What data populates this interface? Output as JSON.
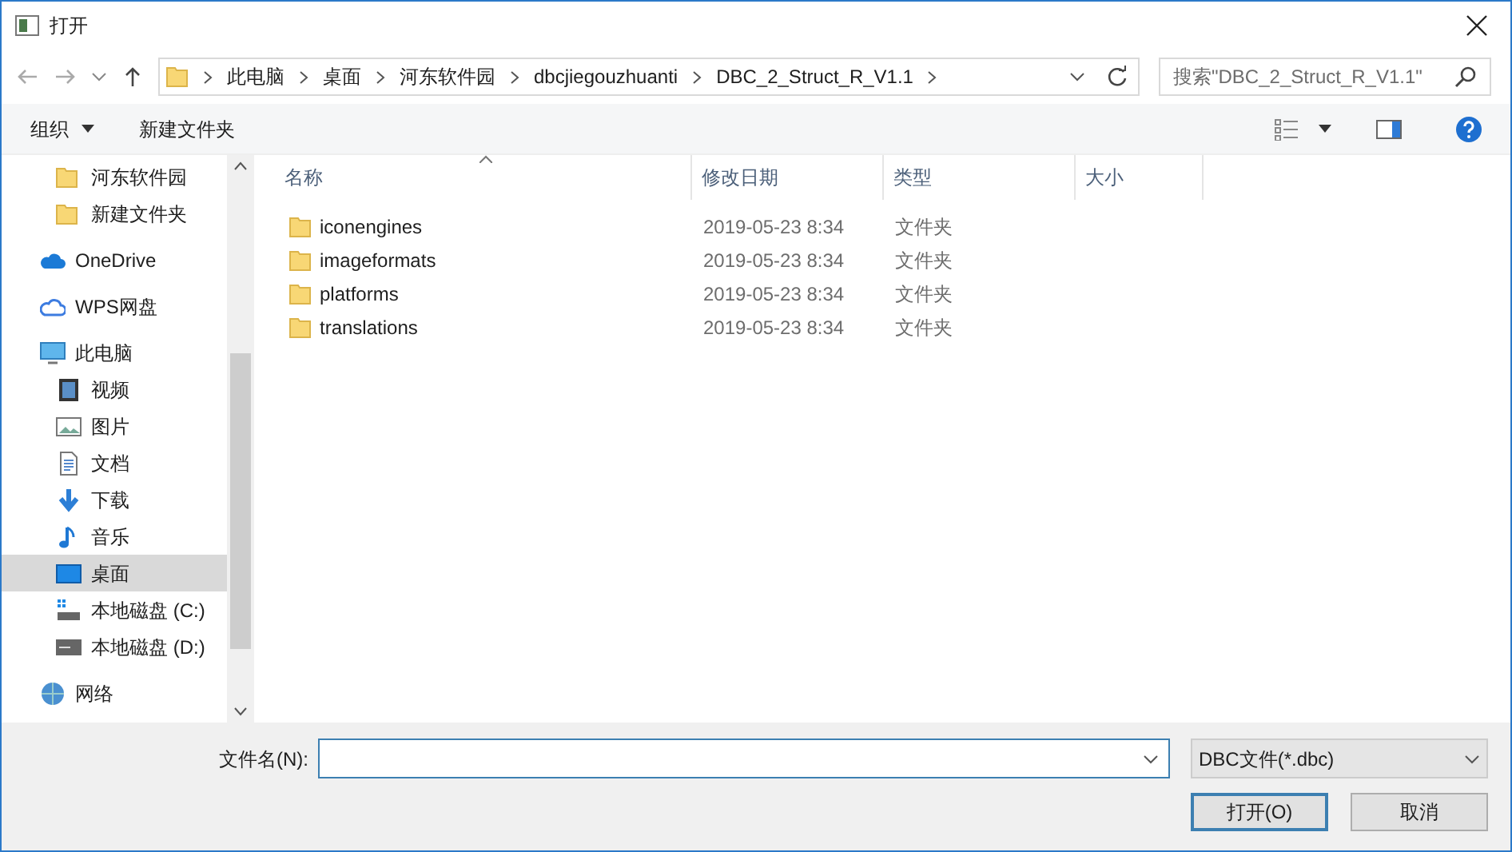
{
  "window": {
    "title": "打开"
  },
  "address_bar": {
    "crumbs": [
      "此电脑",
      "桌面",
      "河东软件园",
      "dbcjiegouzhuanti",
      "DBC_2_Struct_R_V1.1"
    ]
  },
  "search": {
    "placeholder": "搜索\"DBC_2_Struct_R_V1.1\""
  },
  "toolbar": {
    "organize": "组织",
    "new_folder": "新建文件夹"
  },
  "sidebar": {
    "items": [
      {
        "label": "河东软件园",
        "kind": "folder",
        "selected": false
      },
      {
        "label": "新建文件夹",
        "kind": "folder",
        "selected": false
      },
      {
        "label": "OneDrive",
        "kind": "cloud",
        "selected": false
      },
      {
        "label": "WPS网盘",
        "kind": "wps",
        "selected": false
      },
      {
        "label": "此电脑",
        "kind": "pc",
        "selected": false,
        "children": [
          {
            "label": "视频",
            "kind": "video",
            "selected": false
          },
          {
            "label": "图片",
            "kind": "picture",
            "selected": false
          },
          {
            "label": "文档",
            "kind": "document",
            "selected": false
          },
          {
            "label": "下载",
            "kind": "download",
            "selected": false
          },
          {
            "label": "音乐",
            "kind": "music",
            "selected": false
          },
          {
            "label": "桌面",
            "kind": "desktop",
            "selected": true
          },
          {
            "label": "本地磁盘 (C:)",
            "kind": "system-drive",
            "selected": false
          },
          {
            "label": "本地磁盘 (D:)",
            "kind": "drive",
            "selected": false
          }
        ]
      },
      {
        "label": "网络",
        "kind": "network",
        "selected": false
      }
    ]
  },
  "table": {
    "columns": [
      "名称",
      "修改日期",
      "类型",
      "大小"
    ],
    "rows": [
      {
        "name": "iconengines",
        "modified": "2019-05-23 8:34",
        "type": "文件夹"
      },
      {
        "name": "imageformats",
        "modified": "2019-05-23 8:34",
        "type": "文件夹"
      },
      {
        "name": "platforms",
        "modified": "2019-05-23 8:34",
        "type": "文件夹"
      },
      {
        "name": "translations",
        "modified": "2019-05-23 8:34",
        "type": "文件夹"
      }
    ]
  },
  "footer": {
    "filename_label": "文件名(N):",
    "filter": "DBC文件(*.dbc)",
    "open": "打开(O)",
    "cancel": "取消"
  }
}
